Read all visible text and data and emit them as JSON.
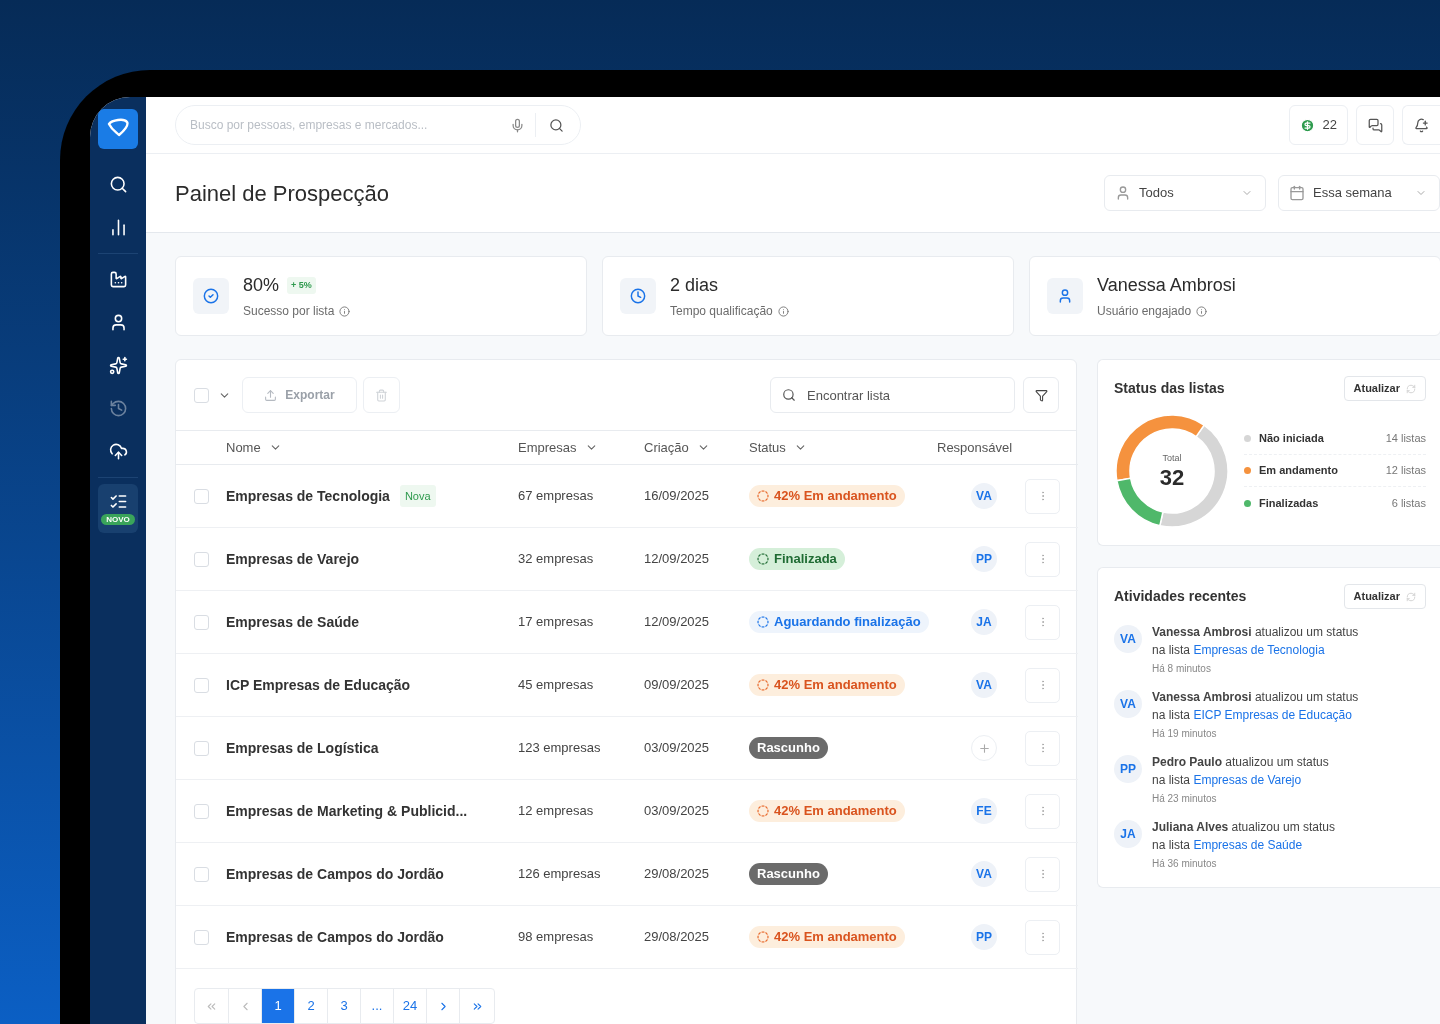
{
  "sidebar": {
    "items": [
      {
        "disabled": false
      },
      {
        "disabled": false
      },
      {
        "disabled": false
      },
      {
        "disabled": false
      },
      {
        "disabled": false
      },
      {
        "disabled": true
      },
      {
        "disabled": false
      },
      {
        "disabled": false,
        "selected": true,
        "badge": "NOVO"
      }
    ]
  },
  "topbar": {
    "search": {
      "placeholder": "Busco por pessoas, empresas e mercados..."
    },
    "credits": "22"
  },
  "page": {
    "title": "Painel de Prospecção",
    "filters": [
      {
        "kind": "user",
        "value": "Todos"
      },
      {
        "kind": "date",
        "value": "Essa semana"
      }
    ]
  },
  "kpis": [
    {
      "kind": "check",
      "value": "80%",
      "badge": "+ 5%",
      "label": "Sucesso por lista"
    },
    {
      "kind": "clock",
      "value": "2 dias",
      "label": "Tempo qualificação"
    },
    {
      "kind": "user",
      "value": "Vanessa Ambrosi",
      "label": "Usuário engajado"
    }
  ],
  "table": {
    "select_all": {
      "checked": false
    },
    "export": {
      "label": "Exportar",
      "disabled": true
    },
    "delete": {
      "disabled": true
    },
    "search": {
      "placeholder": "Encontrar lista"
    },
    "columns": [
      {
        "label": "Nome",
        "sortable": true
      },
      {
        "label": "Empresas",
        "sortable": true
      },
      {
        "label": "Criação",
        "sortable": true
      },
      {
        "label": "Status",
        "sortable": true
      },
      {
        "label": "Responsável",
        "sortable": false
      }
    ],
    "rows": [
      {
        "checked": false,
        "name": "Empresas de Tecnologia",
        "tag": "Nova",
        "companies": "67 empresas",
        "created": "16/09/2025",
        "status": {
          "kind": "progress",
          "text": "42% Em andamento"
        },
        "responsible": "VA"
      },
      {
        "checked": false,
        "name": "Empresas de Varejo",
        "companies": "32 empresas",
        "created": "12/09/2025",
        "status": {
          "kind": "done",
          "text": "Finalizada"
        },
        "responsible": "PP"
      },
      {
        "checked": false,
        "name": "Empresas de Saúde",
        "companies": "17 empresas",
        "created": "12/09/2025",
        "status": {
          "kind": "waiting",
          "text": "Aguardando finalização"
        },
        "responsible": "JA"
      },
      {
        "checked": false,
        "name": "ICP Empresas de Educação",
        "companies": "45 empresas",
        "created": "09/09/2025",
        "status": {
          "kind": "progress",
          "text": "42% Em andamento"
        },
        "responsible": "VA"
      },
      {
        "checked": false,
        "name": "Empresas de Logística",
        "companies": "123 empresas",
        "created": "03/09/2025",
        "status": {
          "kind": "draft",
          "text": "Rascunho"
        }
      },
      {
        "checked": false,
        "name": "Empresas de Marketing & Publicid...",
        "companies": "12 empresas",
        "created": "03/09/2025",
        "status": {
          "kind": "progress",
          "text": "42% Em andamento"
        },
        "responsible": "FE"
      },
      {
        "checked": false,
        "name": "Empresas de Campos do Jordão",
        "companies": "126 empresas",
        "created": "29/08/2025",
        "status": {
          "kind": "draft",
          "text": "Rascunho"
        },
        "responsible": "VA"
      },
      {
        "checked": false,
        "name": "Empresas de Campos do Jordão",
        "companies": "98 empresas",
        "created": "29/08/2025",
        "status": {
          "kind": "progress",
          "text": "42% Em andamento"
        },
        "responsible": "PP"
      }
    ],
    "pagination": {
      "pages": [
        {
          "label": "1",
          "selected": true
        },
        {
          "label": "2",
          "selected": false
        },
        {
          "label": "3",
          "selected": false
        },
        {
          "label": "...",
          "selected": false
        },
        {
          "label": "24",
          "selected": false
        }
      ]
    }
  },
  "status_card": {
    "title": "Status das listas",
    "refresh": "Atualizar",
    "total_label": "Total",
    "total": "32",
    "legend": [
      {
        "count": "14 listas",
        "color": "#d6d6d6"
      },
      {
        "count": "12 listas",
        "color": "#f5923e"
      },
      {
        "count": "6 listas",
        "color": "#4fb86a"
      }
    ],
    "chart_data": {
      "type": "donut",
      "categories": [
        "Não iniciada",
        "Em andamento",
        "Finalizadas"
      ],
      "values": [
        43.75,
        37.5,
        18.75
      ]
    }
  },
  "activities": {
    "title": "Atividades recentes",
    "refresh": "Atualizar",
    "items": [
      {
        "initials": "VA",
        "text": "**Vanessa Ambrosi** atualizou um status",
        "prefix": "na lista",
        "link": "Empresas de Tecnologia",
        "time": "Há 8 minutos"
      },
      {
        "initials": "VA",
        "text": "**Vanessa Ambrosi** atualizou um status",
        "prefix": "na lista",
        "link": "EICP Empresas de Educação",
        "time": "Há 19 minutos"
      },
      {
        "initials": "PP",
        "text": "**Pedro Paulo** atualizou um status",
        "prefix": "na lista",
        "link": "Empresas de Varejo",
        "time": "Há 23 minutos"
      },
      {
        "initials": "JA",
        "text": "**Juliana Alves** atualizou um status",
        "prefix": "na lista",
        "link": "Empresas de Saúde",
        "time": "Há 36 minutos"
      }
    ]
  }
}
